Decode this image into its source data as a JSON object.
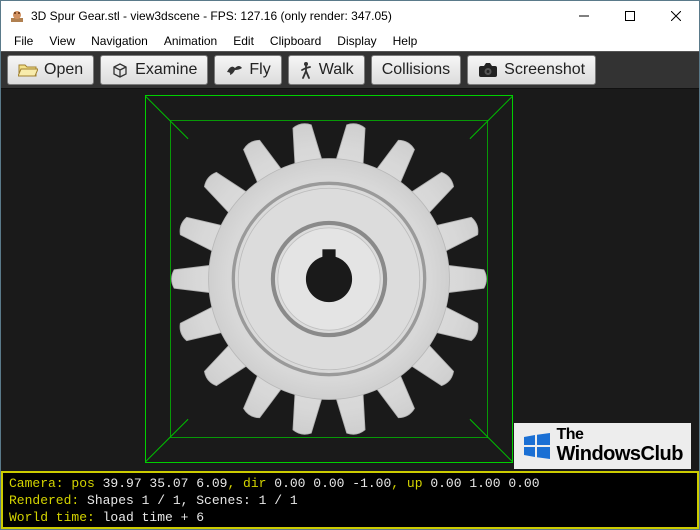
{
  "titlebar": {
    "title": "3D Spur Gear.stl - view3dscene - FPS: 127.16 (only render: 347.05)"
  },
  "menu": {
    "file": "File",
    "view": "View",
    "navigation": "Navigation",
    "animation": "Animation",
    "edit": "Edit",
    "clipboard": "Clipboard",
    "display": "Display",
    "help": "Help"
  },
  "toolbar": {
    "open": "Open",
    "examine": "Examine",
    "fly": "Fly",
    "walk": "Walk",
    "collisions": "Collisions",
    "screenshot": "Screenshot"
  },
  "watermark": {
    "line1": "The",
    "line2": "WindowsClub"
  },
  "console": {
    "camera_label": "Camera:",
    "camera_pos_label": " pos ",
    "camera_pos": "39.97 35.07 6.09",
    "camera_dir_label": ", dir ",
    "camera_dir": "0.00 0.00 -1.00",
    "camera_up_label": ", up ",
    "camera_up": "0.00 1.00 0.00",
    "rendered_label": "Rendered:",
    "rendered_value": " Shapes 1 / 1, Scenes: 1 / 1",
    "worldtime_label": "World time:",
    "worldtime_value": " load time + 6"
  }
}
